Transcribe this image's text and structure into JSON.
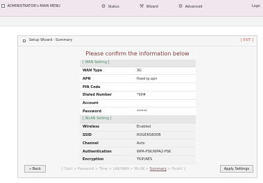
{
  "topnav": {
    "main_menu": "ADMINISTRATOR's MAIN MENU",
    "status": "Status",
    "wizard": "Wizard",
    "advanced": "Advanced",
    "logout": "Logo"
  },
  "panel": {
    "title": "Setup Wizard - Summary",
    "exit": "[ EXIT ]",
    "heading": "Please confirm the information below"
  },
  "wan": {
    "header": "[ WAN Setting ]",
    "rows": [
      {
        "label": "WAN Type",
        "value": "3G"
      },
      {
        "label": "APN",
        "value": "fixed-ip.apn"
      },
      {
        "label": "PIN Code",
        "value": ""
      },
      {
        "label": "Dialed Number",
        "value": "*99#"
      },
      {
        "label": "Account",
        "value": ""
      },
      {
        "label": "Password",
        "value": "******"
      }
    ]
  },
  "wlan": {
    "header": "[ WLAN Setting ]",
    "rows": [
      {
        "label": "Wireless",
        "value": "Enabled"
      },
      {
        "label": "SSID",
        "value": "ROGERS8D0B"
      },
      {
        "label": "Channel",
        "value": "Auto"
      },
      {
        "label": "Authentication",
        "value": "WPA-PSK/WPA2-PSK"
      },
      {
        "label": "Encryption",
        "value": "TKIP/AES"
      }
    ]
  },
  "footer": {
    "back": "« Back",
    "apply": "Apply Settings",
    "steps_prefix": "[ Start > Password > Time > LAN/WAN > WLAN > ",
    "steps_current": "Summary",
    "steps_suffix": " > Finish! ]"
  }
}
